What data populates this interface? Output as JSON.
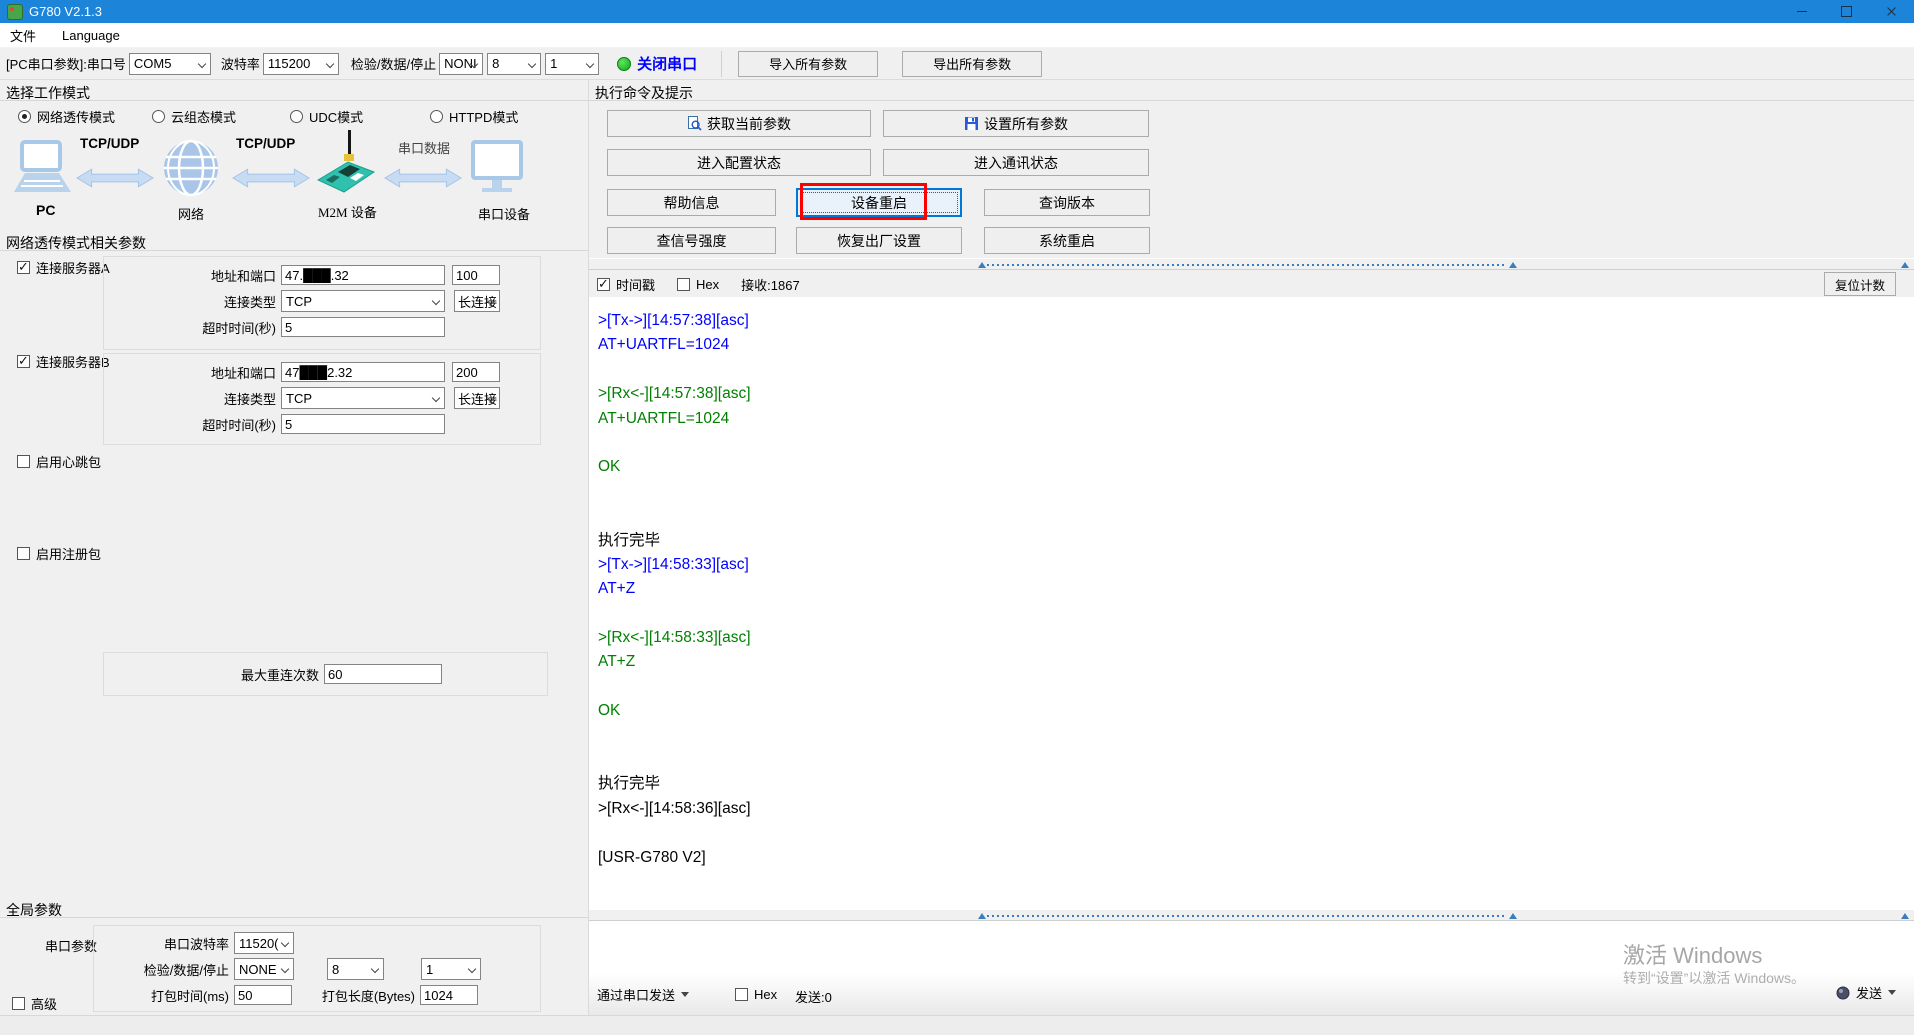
{
  "window": {
    "title": "G780 V2.1.3"
  },
  "menu": {
    "file": "文件",
    "language": "Language"
  },
  "toolbar": {
    "pc_serial_label": "[PC串口参数]:串口号",
    "com_port": "COM5",
    "baud_label": "波特率",
    "baud": "115200",
    "parity_label": "检验/数据/停止",
    "parity": "NONI",
    "data_bits": "8",
    "stop_bits": "1",
    "close_port_label": "关闭串口",
    "import_label": "导入所有参数",
    "export_label": "导出所有参数"
  },
  "work_mode": {
    "title": "选择工作模式",
    "modes": [
      {
        "label": "网络透传模式"
      },
      {
        "label": "云组态模式"
      },
      {
        "label": "UDC模式"
      },
      {
        "label": "HTTPD模式"
      }
    ],
    "diagram": {
      "pc": "PC",
      "network": "网络",
      "m2m": "M2M 设备",
      "serial_device": "串口设备",
      "link1": "TCP/UDP",
      "link2": "TCP/UDP",
      "link3": "串口数据"
    }
  },
  "net_params": {
    "title": "网络透传模式相关参数",
    "server_a": {
      "label": "连接服务器A",
      "addr_label": "地址和端口",
      "address": "47.███.32",
      "port": "100",
      "type_label": "连接类型",
      "type": "TCP",
      "keep": "长连接",
      "timeout_label": "超时时间(秒)",
      "timeout": "5"
    },
    "server_b": {
      "label": "连接服务器B",
      "addr_label": "地址和端口",
      "address": "47███2.32",
      "port": "200",
      "type_label": "连接类型",
      "type": "TCP",
      "keep": "长连接",
      "timeout_label": "超时时间(秒)",
      "timeout": "5"
    },
    "heartbeat_label": "启用心跳包",
    "register_label": "启用注册包",
    "max_reconnect_label": "最大重连次数",
    "max_reconnect": "60"
  },
  "global_params": {
    "title": "全局参数",
    "serial_label": "串口参数",
    "baud_label": "串口波特率",
    "baud": "11520(",
    "parity_label": "检验/数据/停止",
    "parity": "NONE",
    "data_bits": "8",
    "stop_bits": "1",
    "pack_time_label": "打包时间(ms)",
    "pack_time": "50",
    "pack_len_label": "打包长度(Bytes)",
    "pack_len": "1024",
    "advanced_label": "高级"
  },
  "commands": {
    "title": "执行命令及提示",
    "get_params": "获取当前参数",
    "set_params": "设置所有参数",
    "enter_config": "进入配置状态",
    "enter_comm": "进入通讯状态",
    "help": "帮助信息",
    "device_restart": "设备重启",
    "query_version": "查询版本",
    "query_signal": "查信号强度",
    "factory_reset": "恢复出厂设置",
    "system_restart": "系统重启"
  },
  "log": {
    "timestamp_label": "时间戳",
    "hex_label": "Hex",
    "recv_count": "接收:1867",
    "reset_count_label": "复位计数",
    "lines": [
      {
        "text": ">[Tx->][14:57:38][asc]",
        "color": "blue"
      },
      {
        "text": "AT+UARTFL=1024",
        "color": "blue"
      },
      {
        "text": "",
        "color": "k"
      },
      {
        "text": ">[Rx<-][14:57:38][asc]",
        "color": "green"
      },
      {
        "text": "AT+UARTFL=1024",
        "color": "green"
      },
      {
        "text": "",
        "color": "k"
      },
      {
        "text": "OK",
        "color": "green"
      },
      {
        "text": "",
        "color": "k"
      },
      {
        "text": "",
        "color": "k"
      },
      {
        "text": "执行完毕",
        "color": "k"
      },
      {
        "text": ">[Tx->][14:58:33][asc]",
        "color": "blue"
      },
      {
        "text": "AT+Z",
        "color": "blue"
      },
      {
        "text": "",
        "color": "k"
      },
      {
        "text": ">[Rx<-][14:58:33][asc]",
        "color": "green"
      },
      {
        "text": "AT+Z",
        "color": "green"
      },
      {
        "text": "",
        "color": "k"
      },
      {
        "text": "OK",
        "color": "green"
      },
      {
        "text": "",
        "color": "k"
      },
      {
        "text": "",
        "color": "k"
      },
      {
        "text": "执行完毕",
        "color": "k"
      },
      {
        "text": ">[Rx<-][14:58:36][asc]",
        "color": "k"
      },
      {
        "text": "",
        "color": "k"
      },
      {
        "text": "[USR-G780 V2]",
        "color": "k"
      }
    ]
  },
  "send": {
    "via_serial_label": "通过串口发送",
    "hex_label": "Hex",
    "sent_count": "发送:0",
    "send_label": "发送"
  },
  "watermark": {
    "line1": "激活 Windows",
    "line2": "转到“设置”以激活 Windows。"
  },
  "colors": {
    "titlebar": "#1c84d9",
    "log_blue": "#0000ff",
    "log_green": "#008000",
    "highlight_red": "#ff0000",
    "led_green": "#21c421",
    "focus_blue": "#0078d7"
  }
}
